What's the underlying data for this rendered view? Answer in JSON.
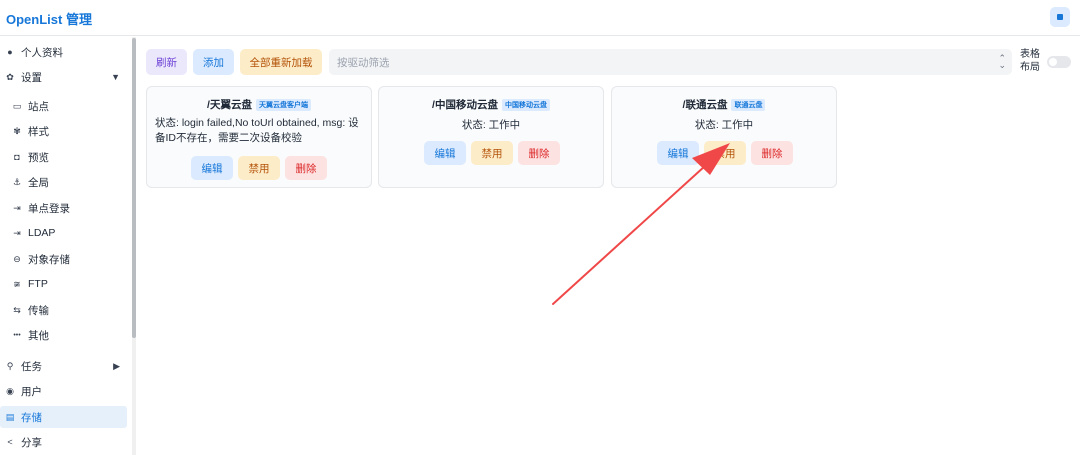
{
  "app": {
    "title": "OpenList 管理"
  },
  "sidebar": {
    "items": [
      {
        "label": "个人资料",
        "icon": "●"
      },
      {
        "label": "设置",
        "icon": "✿"
      },
      {
        "label": "站点",
        "icon": "▭"
      },
      {
        "label": "样式",
        "icon": "✾"
      },
      {
        "label": "预览",
        "icon": "◘"
      },
      {
        "label": "全局",
        "icon": "⚓"
      },
      {
        "label": "单点登录",
        "icon": "⇥"
      },
      {
        "label": "LDAP",
        "icon": "⇥"
      },
      {
        "label": "对象存储",
        "icon": "⊖"
      },
      {
        "label": "FTP",
        "icon": "≆"
      },
      {
        "label": "传输",
        "icon": "⇆"
      },
      {
        "label": "其他",
        "icon": "•••"
      },
      {
        "label": "任务",
        "icon": "⚲"
      },
      {
        "label": "用户",
        "icon": "◉"
      },
      {
        "label": "存储",
        "icon": "▤"
      },
      {
        "label": "分享",
        "icon": "<"
      }
    ]
  },
  "toolbar": {
    "refresh_label": "刷新",
    "add_label": "添加",
    "reload_label": "全部重新加载",
    "filter_placeholder": "按驱动筛选",
    "table_layout_label": "表格布局"
  },
  "cards": [
    {
      "path": "/天翼云盘",
      "driver": "天翼云盘客户端",
      "status": "状态: login failed,No toUrl obtained, msg: 设备ID不存在，需要二次设备校验",
      "edit": "编辑",
      "disable": "禁用",
      "delete": "删除"
    },
    {
      "path": "/中国移动云盘",
      "driver": "中国移动云盘",
      "status": "状态: 工作中",
      "edit": "编辑",
      "disable": "禁用",
      "delete": "删除"
    },
    {
      "path": "/联通云盘",
      "driver": "联通云盘",
      "status": "状态: 工作中",
      "edit": "编辑",
      "disable": "禁用",
      "delete": "删除"
    }
  ],
  "colors": {
    "accent": "#1677d9",
    "annotation_arrow": "#f04848"
  }
}
